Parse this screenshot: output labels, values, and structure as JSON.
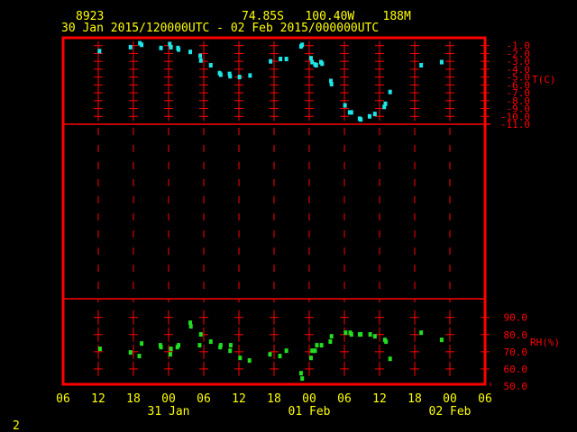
{
  "header": {
    "station": "8923",
    "location": "74.85S   100.40W    188M",
    "period": "30 Jan 2015/120000UTC - 02 Feb 2015/000000UTC"
  },
  "footer": {
    "page": "2"
  },
  "colors": {
    "frame": "#ff0000",
    "text": "#ffff00",
    "temperature": "#1ee6e6",
    "humidity": "#22dd22",
    "background": "#000000"
  },
  "chart_data": [
    {
      "type": "scatter",
      "panel": "top",
      "ylabel": "T(C)",
      "ylim": [
        -11.0,
        -1.0
      ],
      "yticks": [
        "-1.0",
        "-2.0",
        "-3.0",
        "-4.0",
        "-5.0",
        "-6.0",
        "-7.0",
        "-8.0",
        "-9.0",
        "-10.0",
        "-11.0"
      ],
      "xlim": [
        "2015-01-30T06:00",
        "2015-02-02T06:00"
      ],
      "points": [
        [
          "2015-01-30T12:12",
          -1.7
        ],
        [
          "2015-01-30T17:30",
          -1.2
        ],
        [
          "2015-01-30T19:06",
          -0.7
        ],
        [
          "2015-01-30T19:24",
          -0.9
        ],
        [
          "2015-01-30T22:42",
          -1.3
        ],
        [
          "2015-01-31T00:12",
          -0.8
        ],
        [
          "2015-01-31T00:24",
          -1.2
        ],
        [
          "2015-01-31T01:36",
          -1.3
        ],
        [
          "2015-01-31T01:42",
          -1.5
        ],
        [
          "2015-01-31T03:42",
          -1.8
        ],
        [
          "2015-01-31T05:24",
          -2.3
        ],
        [
          "2015-01-31T05:30",
          -2.9
        ],
        [
          "2015-01-31T07:12",
          -3.5
        ],
        [
          "2015-01-31T08:42",
          -4.5
        ],
        [
          "2015-01-31T08:54",
          -4.7
        ],
        [
          "2015-01-31T10:24",
          -4.6
        ],
        [
          "2015-01-31T10:30",
          -4.9
        ],
        [
          "2015-01-31T12:06",
          -5.0
        ],
        [
          "2015-01-31T13:54",
          -4.8
        ],
        [
          "2015-01-31T17:24",
          -3.0
        ],
        [
          "2015-01-31T19:06",
          -2.7
        ],
        [
          "2015-01-31T20:06",
          -2.7
        ],
        [
          "2015-01-31T22:36",
          -1.1
        ],
        [
          "2015-01-31T22:48",
          -0.9
        ],
        [
          "2015-02-01T00:18",
          -2.6
        ],
        [
          "2015-02-01T00:30",
          -3.1
        ],
        [
          "2015-02-01T01:00",
          -3.4
        ],
        [
          "2015-02-01T01:12",
          -3.5
        ],
        [
          "2015-02-01T02:00",
          -3.1
        ],
        [
          "2015-02-01T02:12",
          -3.3
        ],
        [
          "2015-02-01T03:42",
          -5.5
        ],
        [
          "2015-02-01T03:48",
          -5.9
        ],
        [
          "2015-02-01T06:06",
          -8.6
        ],
        [
          "2015-02-01T06:54",
          -9.5
        ],
        [
          "2015-02-01T07:12",
          -9.5
        ],
        [
          "2015-02-01T08:36",
          -10.3
        ],
        [
          "2015-02-01T08:48",
          -10.4
        ],
        [
          "2015-02-01T10:18",
          -10.0
        ],
        [
          "2015-02-01T11:12",
          -9.7
        ],
        [
          "2015-02-01T12:48",
          -8.8
        ],
        [
          "2015-02-01T13:00",
          -8.4
        ],
        [
          "2015-02-01T13:48",
          -6.9
        ],
        [
          "2015-02-01T19:06",
          -3.5
        ],
        [
          "2015-02-01T22:36",
          -3.1
        ]
      ]
    },
    {
      "type": "scatter",
      "panel": "bottom",
      "ylabel": "RH(%)",
      "ylim": [
        50.0,
        90.0
      ],
      "yticks": [
        "90.0",
        "80.0",
        "70.0",
        "60.0",
        "50.0"
      ],
      "xlim": [
        "2015-01-30T06:00",
        "2015-02-02T06:00"
      ],
      "xticks": [
        "06",
        "12",
        "18",
        "00",
        "06",
        "12",
        "18",
        "00",
        "06",
        "12",
        "18",
        "00",
        "06"
      ],
      "date_labels": [
        "31 Jan",
        "01 Feb",
        "02 Feb"
      ],
      "points": [
        [
          "2015-01-30T12:18",
          71.7
        ],
        [
          "2015-01-30T17:30",
          69.6
        ],
        [
          "2015-01-30T19:00",
          67.5
        ],
        [
          "2015-01-30T19:24",
          74.8
        ],
        [
          "2015-01-30T22:36",
          73.8
        ],
        [
          "2015-01-30T22:42",
          72.7
        ],
        [
          "2015-01-31T00:18",
          68.5
        ],
        [
          "2015-01-31T00:24",
          71.7
        ],
        [
          "2015-01-31T01:30",
          72.7
        ],
        [
          "2015-01-31T01:42",
          73.8
        ],
        [
          "2015-01-31T03:42",
          86.9
        ],
        [
          "2015-01-31T03:48",
          84.8
        ],
        [
          "2015-01-31T05:18",
          73.8
        ],
        [
          "2015-01-31T05:30",
          80.1
        ],
        [
          "2015-01-31T07:12",
          75.9
        ],
        [
          "2015-01-31T08:48",
          72.7
        ],
        [
          "2015-01-31T08:54",
          73.8
        ],
        [
          "2015-01-31T10:30",
          70.6
        ],
        [
          "2015-01-31T10:36",
          73.8
        ],
        [
          "2015-01-31T12:12",
          66.4
        ],
        [
          "2015-01-31T13:48",
          64.9
        ],
        [
          "2015-01-31T17:18",
          68.5
        ],
        [
          "2015-01-31T19:00",
          67.5
        ],
        [
          "2015-01-31T20:06",
          70.6
        ],
        [
          "2015-01-31T22:36",
          57.5
        ],
        [
          "2015-01-31T22:48",
          54.4
        ],
        [
          "2015-02-01T00:18",
          66.4
        ],
        [
          "2015-02-01T00:30",
          70.6
        ],
        [
          "2015-02-01T01:00",
          70.6
        ],
        [
          "2015-02-01T01:18",
          73.8
        ],
        [
          "2015-02-01T02:06",
          73.8
        ],
        [
          "2015-02-01T03:36",
          75.9
        ],
        [
          "2015-02-01T03:48",
          79.0
        ],
        [
          "2015-02-01T06:12",
          81.1
        ],
        [
          "2015-02-01T07:00",
          81.1
        ],
        [
          "2015-02-01T07:12",
          80.1
        ],
        [
          "2015-02-01T08:36",
          80.1
        ],
        [
          "2015-02-01T08:48",
          80.1
        ],
        [
          "2015-02-01T10:24",
          80.1
        ],
        [
          "2015-02-01T11:12",
          79.0
        ],
        [
          "2015-02-01T12:54",
          76.9
        ],
        [
          "2015-02-01T13:06",
          75.9
        ],
        [
          "2015-02-01T13:48",
          65.9
        ],
        [
          "2015-02-01T19:06",
          81.1
        ],
        [
          "2015-02-01T22:36",
          76.9
        ]
      ]
    }
  ]
}
